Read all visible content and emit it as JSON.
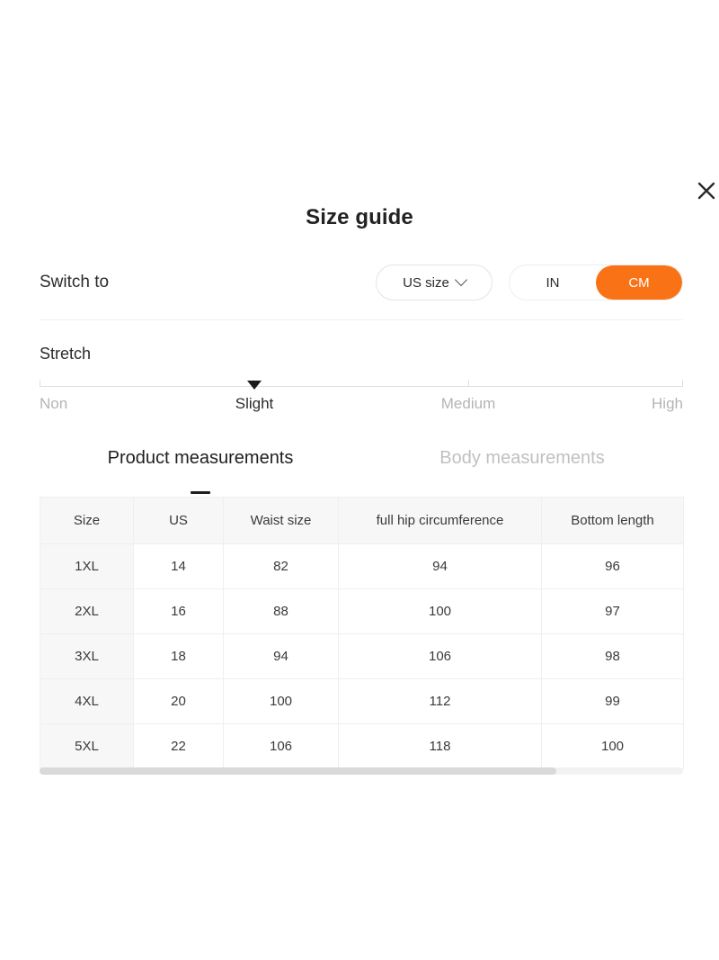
{
  "modal": {
    "title": "Size guide",
    "close_icon": "close-icon"
  },
  "switch": {
    "label": "Switch to",
    "size_system": {
      "value": "US size",
      "icon": "chevron-down-icon"
    },
    "units": {
      "options": [
        "IN",
        "CM"
      ],
      "selected": "CM",
      "active_color": "#f97316"
    }
  },
  "stretch": {
    "label": "Stretch",
    "levels": [
      "Non",
      "Slight",
      "Medium",
      "High"
    ],
    "selected": "Slight"
  },
  "tabs": [
    {
      "label": "Product measurements",
      "active": true
    },
    {
      "label": "Body measurements",
      "active": false
    }
  ],
  "table": {
    "headers": [
      "Size",
      "US",
      "Waist size",
      "full hip circumference",
      "Bottom length"
    ],
    "rows": [
      [
        "1XL",
        "14",
        "82",
        "94",
        "96"
      ],
      [
        "2XL",
        "16",
        "88",
        "100",
        "97"
      ],
      [
        "3XL",
        "18",
        "94",
        "106",
        "98"
      ],
      [
        "4XL",
        "20",
        "100",
        "112",
        "99"
      ],
      [
        "5XL",
        "22",
        "106",
        "118",
        "100"
      ]
    ]
  }
}
